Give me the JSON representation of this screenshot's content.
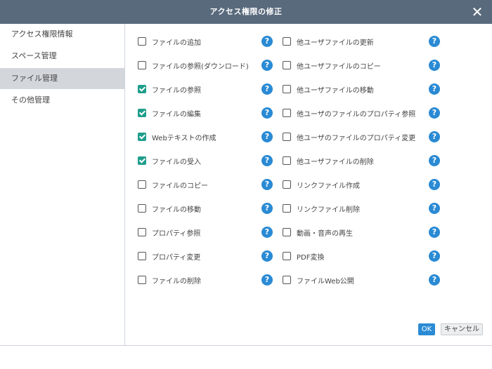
{
  "dialog": {
    "title": "アクセス権限の修正",
    "close_glyph": "✕"
  },
  "sidebar": {
    "items": [
      {
        "label": "アクセス権限情報",
        "active": false
      },
      {
        "label": "スペース管理",
        "active": false
      },
      {
        "label": "ファイル管理",
        "active": true
      },
      {
        "label": "その他管理",
        "active": false
      }
    ]
  },
  "permissions": {
    "left": [
      {
        "label": "ファイルの追加",
        "checked": false
      },
      {
        "label": "ファイルの参照(ダウンロード)",
        "checked": false
      },
      {
        "label": "ファイルの参照",
        "checked": true
      },
      {
        "label": "ファイルの編集",
        "checked": true
      },
      {
        "label": "Webテキストの作成",
        "checked": true
      },
      {
        "label": "ファイルの受入",
        "checked": true
      },
      {
        "label": "ファイルのコピー",
        "checked": false
      },
      {
        "label": "ファイルの移動",
        "checked": false
      },
      {
        "label": "プロパティ参照",
        "checked": false
      },
      {
        "label": "プロパティ変更",
        "checked": false
      },
      {
        "label": "ファイルの削除",
        "checked": false
      }
    ],
    "right": [
      {
        "label": "他ユーザファイルの更新",
        "checked": false
      },
      {
        "label": "他ユーザファイルのコピー",
        "checked": false
      },
      {
        "label": "他ユーザファイルの移動",
        "checked": false
      },
      {
        "label": "他ユーザのファイルのプロパティ参照",
        "checked": false
      },
      {
        "label": "他ユーザのファイルのプロパティ変更",
        "checked": false
      },
      {
        "label": "他ユーザファイルの削除",
        "checked": false
      },
      {
        "label": "リンクファイル作成",
        "checked": false
      },
      {
        "label": "リンクファイル削除",
        "checked": false
      },
      {
        "label": "動画・音声の再生",
        "checked": false
      },
      {
        "label": "PDF変換",
        "checked": false
      },
      {
        "label": "ファイルWeb公開",
        "checked": false
      }
    ],
    "help_glyph": "?"
  },
  "footer": {
    "ok_label": "OK",
    "cancel_label": "キャンセル"
  },
  "colors": {
    "titlebar": "#5a6a7d",
    "checkbox_checked": "#1f9e8c",
    "help_icon": "#2a8ad4",
    "ok_button": "#2a8ad4",
    "sidebar_active": "#d3d7dc"
  }
}
